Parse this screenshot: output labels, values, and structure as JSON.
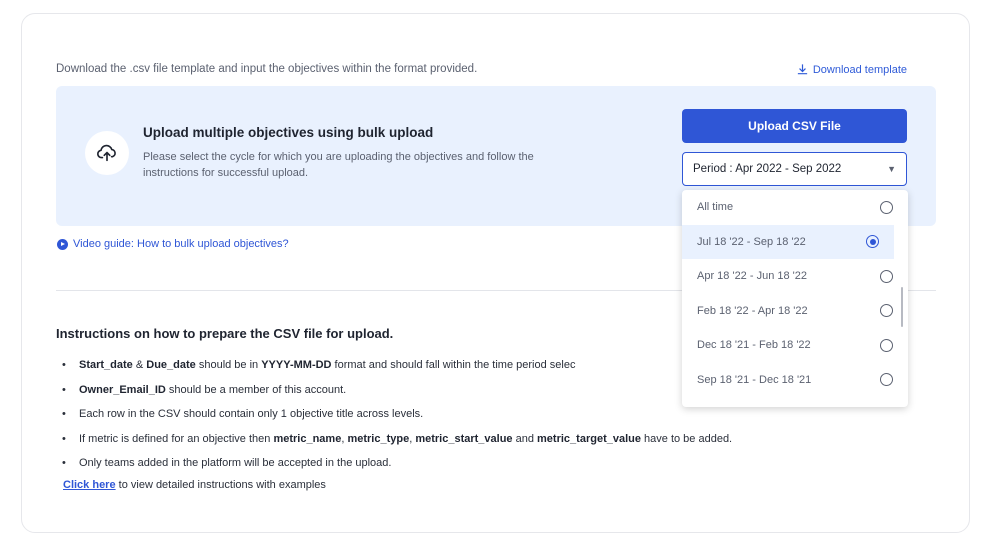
{
  "intro_text": "Download the .csv file template and input the objectives within the format provided.",
  "download_template_label": "Download template",
  "upload": {
    "title": "Upload multiple objectives using bulk upload",
    "description": "Please select the cycle for which you are uploading the objectives and follow the instructions for successful upload.",
    "button_label": "Upload CSV File",
    "period_label": "Period : Apr 2022 - Sep 2022"
  },
  "video_guide_label": "Video guide: How to bulk upload objectives?",
  "instructions": {
    "title": "Instructions on how to prepare the CSV file for upload.",
    "items": [
      {
        "parts": [
          {
            "t": "Start_date",
            "b": true
          },
          {
            "t": " & ",
            "b": false
          },
          {
            "t": "Due_date",
            "b": true
          },
          {
            "t": " should be in ",
            "b": false
          },
          {
            "t": "YYYY-MM-DD",
            "b": true
          },
          {
            "t": " format and should fall within the time period selec",
            "b": false
          }
        ]
      },
      {
        "parts": [
          {
            "t": "Owner_Email_ID",
            "b": true
          },
          {
            "t": " should be a member of this account.",
            "b": false
          }
        ]
      },
      {
        "parts": [
          {
            "t": "Each row in the CSV should contain only 1 objective title across levels.",
            "b": false
          }
        ]
      },
      {
        "parts": [
          {
            "t": "If metric is defined for an objective then ",
            "b": false
          },
          {
            "t": "metric_name",
            "b": true
          },
          {
            "t": ", ",
            "b": false
          },
          {
            "t": "metric_type",
            "b": true
          },
          {
            "t": ", ",
            "b": false
          },
          {
            "t": "metric_start_value",
            "b": true
          },
          {
            "t": " and ",
            "b": false
          },
          {
            "t": "metric_target_value",
            "b": true
          },
          {
            "t": " have to be added.",
            "b": false
          }
        ]
      },
      {
        "parts": [
          {
            "t": "Only teams added in the platform will be accepted in the upload.",
            "b": false
          }
        ]
      }
    ],
    "click_here": "Click here",
    "click_here_suffix": " to view detailed instructions with examples"
  },
  "period_options": [
    {
      "label": "All time",
      "selected": false
    },
    {
      "label": "Jul 18 '22 - Sep 18 '22",
      "selected": true
    },
    {
      "label": "Apr 18 '22 - Jun 18 '22",
      "selected": false
    },
    {
      "label": "Feb 18 '22 - Apr 18 '22",
      "selected": false
    },
    {
      "label": "Dec 18 '21 - Feb 18 '22",
      "selected": false
    },
    {
      "label": "Sep 18 '21 - Dec 18 '21",
      "selected": false
    }
  ],
  "colors": {
    "accent": "#2f56d6",
    "panel_bg": "#e9f1fe"
  },
  "icons": [
    "download-icon",
    "upload-cloud-icon",
    "chevron-down-icon",
    "play-icon"
  ]
}
